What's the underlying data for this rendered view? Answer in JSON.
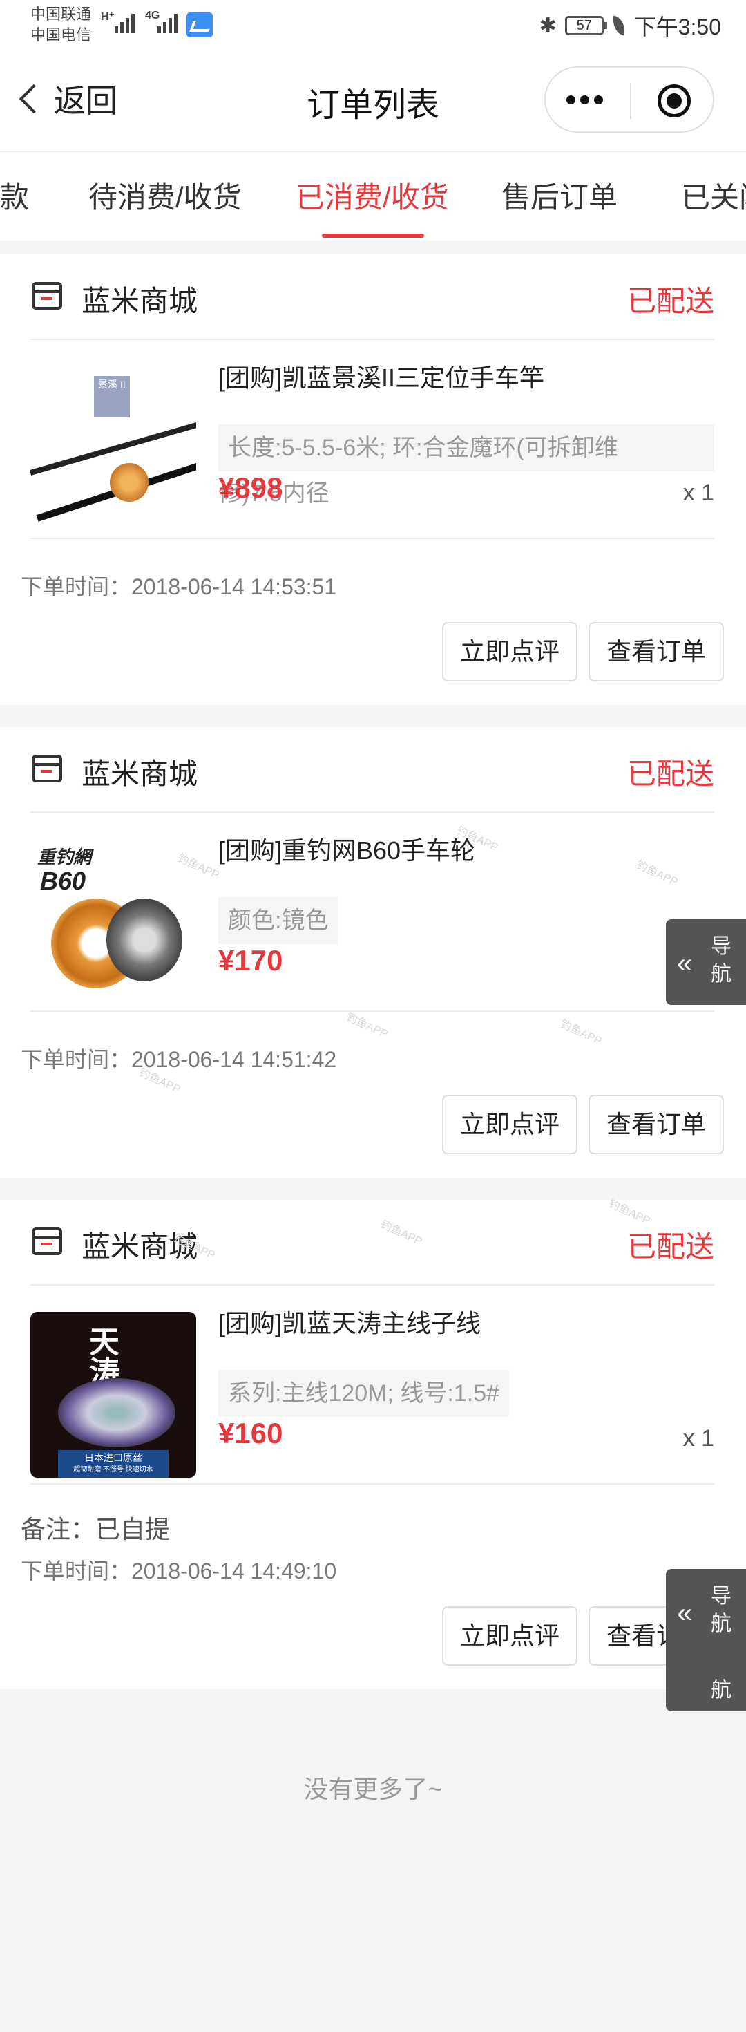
{
  "status_bar": {
    "carrier1": "中国联通",
    "carrier2": "中国电信",
    "net1": "H⁺",
    "net2": "4G",
    "battery": "57",
    "time": "下午3:50"
  },
  "nav": {
    "back_label": "返回",
    "title": "订单列表"
  },
  "tabs": [
    {
      "label": "款",
      "active": false
    },
    {
      "label": "待消费/收货",
      "active": false
    },
    {
      "label": "已消费/收货",
      "active": true
    },
    {
      "label": "售后订单",
      "active": false
    },
    {
      "label": "已关闭",
      "active": false
    }
  ],
  "orders": [
    {
      "store": "蓝米商城",
      "status": "已配送",
      "product_title": "[团购]凯蓝景溪II三定位手车竿",
      "spec": "长度:5-5.5-6米; 环:合金魔环(可拆卸维",
      "spec_overflow": "修)7.5内径",
      "price": "¥898",
      "qty": "x 1",
      "image_label": "景溪 II",
      "order_time": "下单时间：2018-06-14 14:53:51",
      "btn_review": "立即点评",
      "btn_view": "查看订单"
    },
    {
      "store": "蓝米商城",
      "status": "已配送",
      "product_title": "[团购]重钓网B60手车轮",
      "spec": "颜色:镜色",
      "price": "¥170",
      "image_brand": "重钓網",
      "image_model": "B60",
      "order_time": "下单时间：2018-06-14 14:51:42",
      "btn_review": "立即点评",
      "btn_view": "查看订单"
    },
    {
      "store": "蓝米商城",
      "status": "已配送",
      "product_title": "[团购]凯蓝天涛主线子线",
      "spec": "系列:主线120M; 线号:1.5#",
      "price": "¥160",
      "qty": "x 1",
      "image_title": "天涛",
      "image_band": "日本进口原丝",
      "image_band_sub": "超韧耐磨 不涨号 快速切水",
      "note": "备注：已自提",
      "order_time": "下单时间：2018-06-14 14:49:10",
      "btn_review": "立即点评",
      "btn_view": "查看订单"
    }
  ],
  "float_nav": {
    "label": "导航",
    "chevrons": "«"
  },
  "float_nav_under": "航",
  "no_more": "没有更多了~",
  "watermark": "钓鱼APP",
  "colors": {
    "accent": "#e4393c",
    "float_nav_bg": "#555555"
  }
}
